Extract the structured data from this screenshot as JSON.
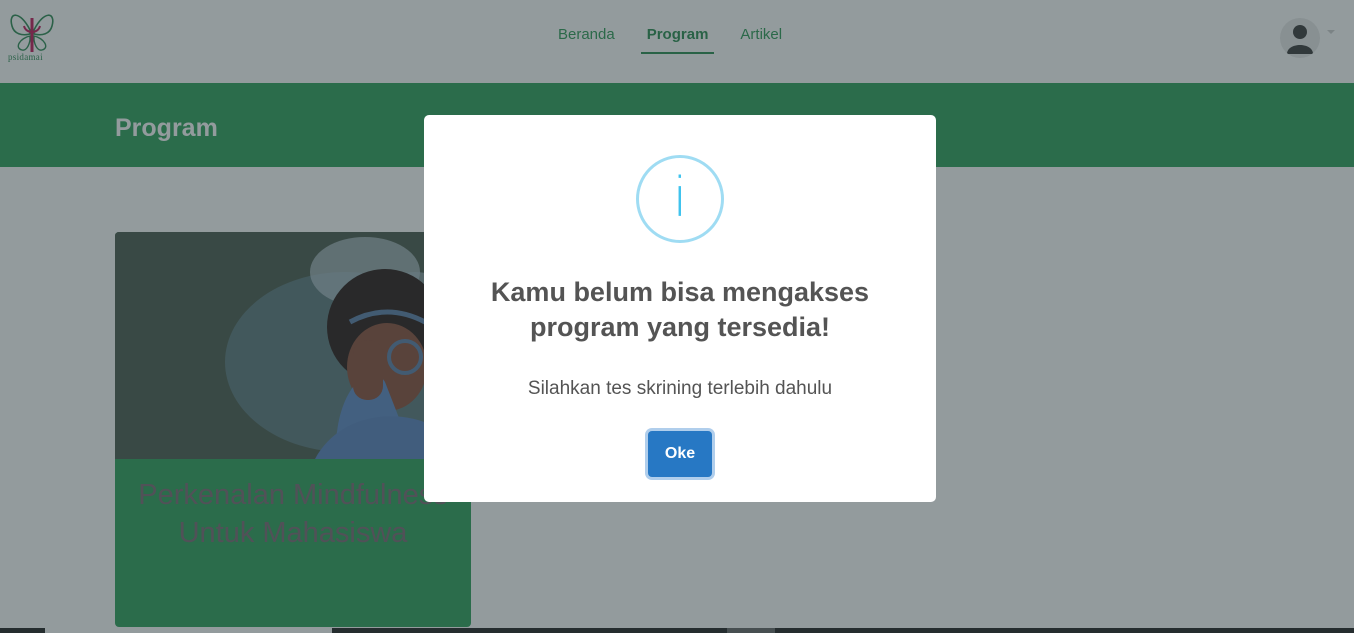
{
  "header": {
    "logo_text": "psidamai",
    "nav": [
      {
        "label": "Beranda",
        "active": false
      },
      {
        "label": "Program",
        "active": true
      },
      {
        "label": "Artikel",
        "active": false
      }
    ]
  },
  "banner": {
    "title": "Program"
  },
  "program_card": {
    "title": "Perkenalan Mindfulness Untuk Mahasiswa"
  },
  "modal": {
    "icon": "info-icon",
    "title": "Kamu belum bisa mengakses program yang tersedia!",
    "text": "Silahkan tes skrining terlebih dahulu",
    "ok_label": "Oke"
  },
  "colors": {
    "brand_green": "#2ea05b",
    "nav_green": "#2f9a57",
    "info_blue": "#3fc3ee",
    "button_blue": "#2778c4"
  }
}
